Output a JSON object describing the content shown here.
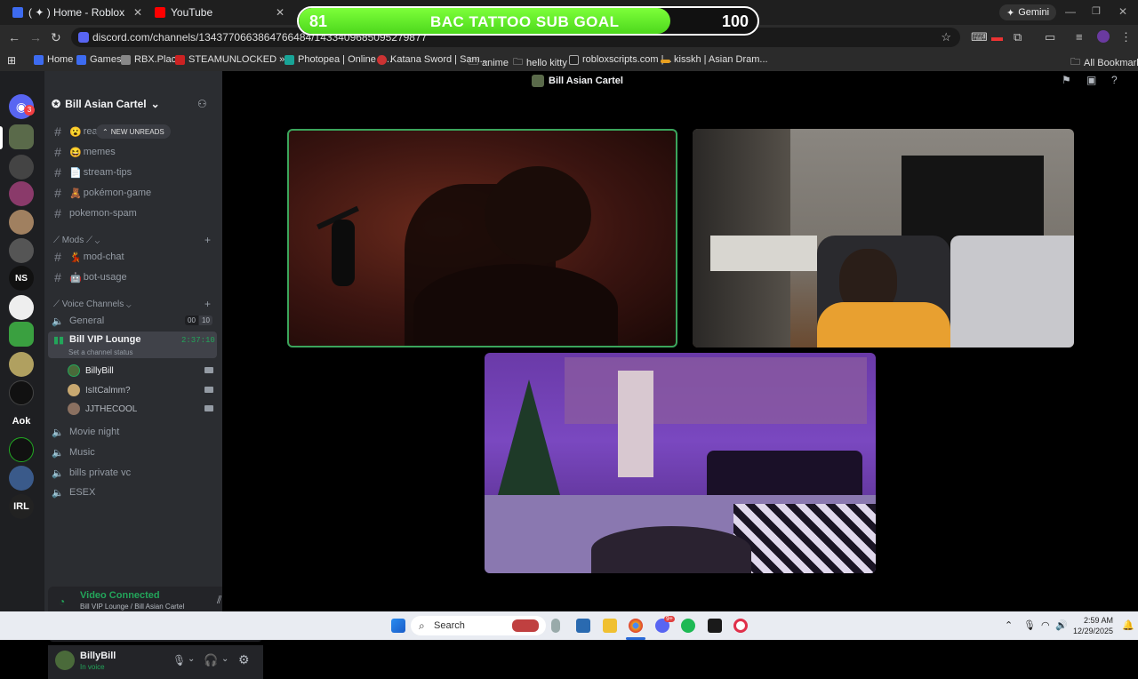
{
  "browser": {
    "tabs": [
      {
        "label": "( ✦ ) Home - Roblox"
      },
      {
        "label": "YouTube"
      }
    ],
    "url": "discord.com/channels/1343770663864766484/1433409685095279877",
    "gemini_label": "Gemini",
    "bookmarks": [
      {
        "label": "Home"
      },
      {
        "label": "Games"
      },
      {
        "label": "RBX.Place"
      },
      {
        "label": "STEAMUNLOCKED »..."
      },
      {
        "label": "Photopea | Online P..."
      },
      {
        "label": "Katana Sword | Sam..."
      },
      {
        "label": "anime"
      },
      {
        "label": "hello kitty"
      },
      {
        "label": "robloxscripts.com |..."
      },
      {
        "label": "kisskh | Asian Dram..."
      },
      {
        "label": "All Bookmarks"
      }
    ]
  },
  "goal": {
    "start": "81",
    "title": "BAC TATTOO SUB GOAL",
    "end": "100",
    "progress_fraction": 0.81
  },
  "discord": {
    "server_badge": "3",
    "server_labels": [
      "NS",
      "Aok",
      "IRL"
    ],
    "server_name": "Bill Asian Cartel",
    "top_title": "Bill Asian Cartel",
    "new_unreads": "NEW UNREADS",
    "text_channels": [
      {
        "emoji": "😮",
        "name": "rea"
      },
      {
        "emoji": "😆",
        "name": "memes"
      },
      {
        "emoji": "📄",
        "name": "stream-tips"
      },
      {
        "emoji": "🧸",
        "name": "pokémon-game"
      },
      {
        "emoji": "",
        "name": "pokemon-spam"
      }
    ],
    "mods_category": "Mods",
    "mods_channels": [
      {
        "emoji": "💃",
        "name": "mod-chat"
      },
      {
        "emoji": "🤖",
        "name": "bot-usage"
      }
    ],
    "voice_category": "Voice Channels",
    "general": {
      "name": "General",
      "count_a": "00",
      "count_b": "10"
    },
    "vip_lounge": {
      "name": "Bill VIP Lounge",
      "timer": "2:37:10",
      "status": "Set a channel status"
    },
    "voice_users": [
      {
        "name": "BillyBill"
      },
      {
        "name": "IsItCalmm?"
      },
      {
        "name": "JJTHECOOL"
      }
    ],
    "other_voice": [
      {
        "name": "Movie night"
      },
      {
        "name": "Music"
      },
      {
        "name": "bills private vc"
      },
      {
        "name": "ESEX"
      }
    ],
    "voice_panel": {
      "status": "Video Connected",
      "location": "Bill VIP Lounge / Bill Asian Cartel"
    },
    "user": {
      "name": "BillyBill",
      "status": "In voice"
    }
  },
  "taskbar": {
    "search_placeholder": "Search",
    "time": "2:59 AM",
    "date": "12/29/2025",
    "badge": "9+"
  },
  "colors": {
    "goal_green": "#4dd81c",
    "discord_green": "#23a55a",
    "rail_bg": "#1e1f22",
    "sidebar_bg": "#2b2d31"
  }
}
